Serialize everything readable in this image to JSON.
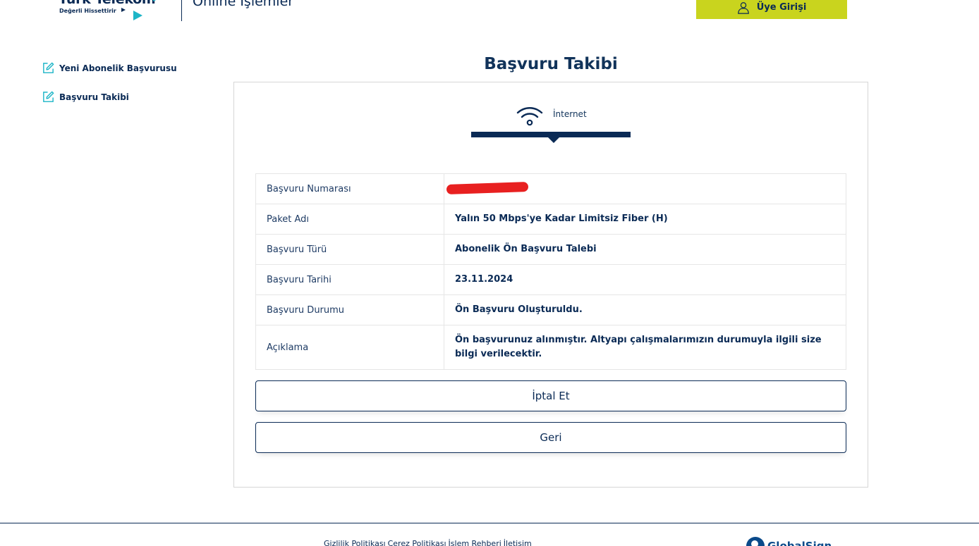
{
  "header": {
    "logo_name": "Türk Telekom",
    "logo_slogan": "Değerli Hissettirir",
    "section_title": "Online İşlemler",
    "login_label": "Üye Girişi"
  },
  "sidebar": {
    "items": [
      {
        "label": "Yeni Abonelik Başvurusu",
        "icon": "edit-icon"
      },
      {
        "label": "Başvuru Takibi",
        "icon": "edit-icon"
      }
    ]
  },
  "main": {
    "title": "Başvuru Takibi",
    "tab": {
      "label": "İnternet",
      "icon": "wifi-icon"
    },
    "rows": [
      {
        "label": "Başvuru Numarası",
        "value": ""
      },
      {
        "label": "Paket Adı",
        "value": "Yalın 50 Mbps'ye Kadar Limitsiz Fiber (H)"
      },
      {
        "label": "Başvuru Türü",
        "value": "Abonelik Ön Başvuru Talebi"
      },
      {
        "label": "Başvuru Tarihi",
        "value": "23.11.2024"
      },
      {
        "label": "Başvuru Durumu",
        "value": "Ön Başvuru Oluşturuldu."
      },
      {
        "label": "Açıklama",
        "value": "Ön başvurunuz alınmıştır. Altyapı çalışmalarımızın durumuyla ilgili size bilgi verilecektir."
      }
    ],
    "cancel_label": "İptal Et",
    "back_label": "Geri"
  },
  "footer": {
    "links": [
      "Gizlilik Politikası",
      "Çerez Politikası",
      "İşlem Rehberi",
      "İletişim"
    ],
    "badge": "GlobalSign"
  },
  "colors": {
    "brand_navy": "#0a2a55",
    "brand_cyan": "#1db5c7",
    "login_button": "#c9d41e",
    "redaction": "#e82020"
  }
}
